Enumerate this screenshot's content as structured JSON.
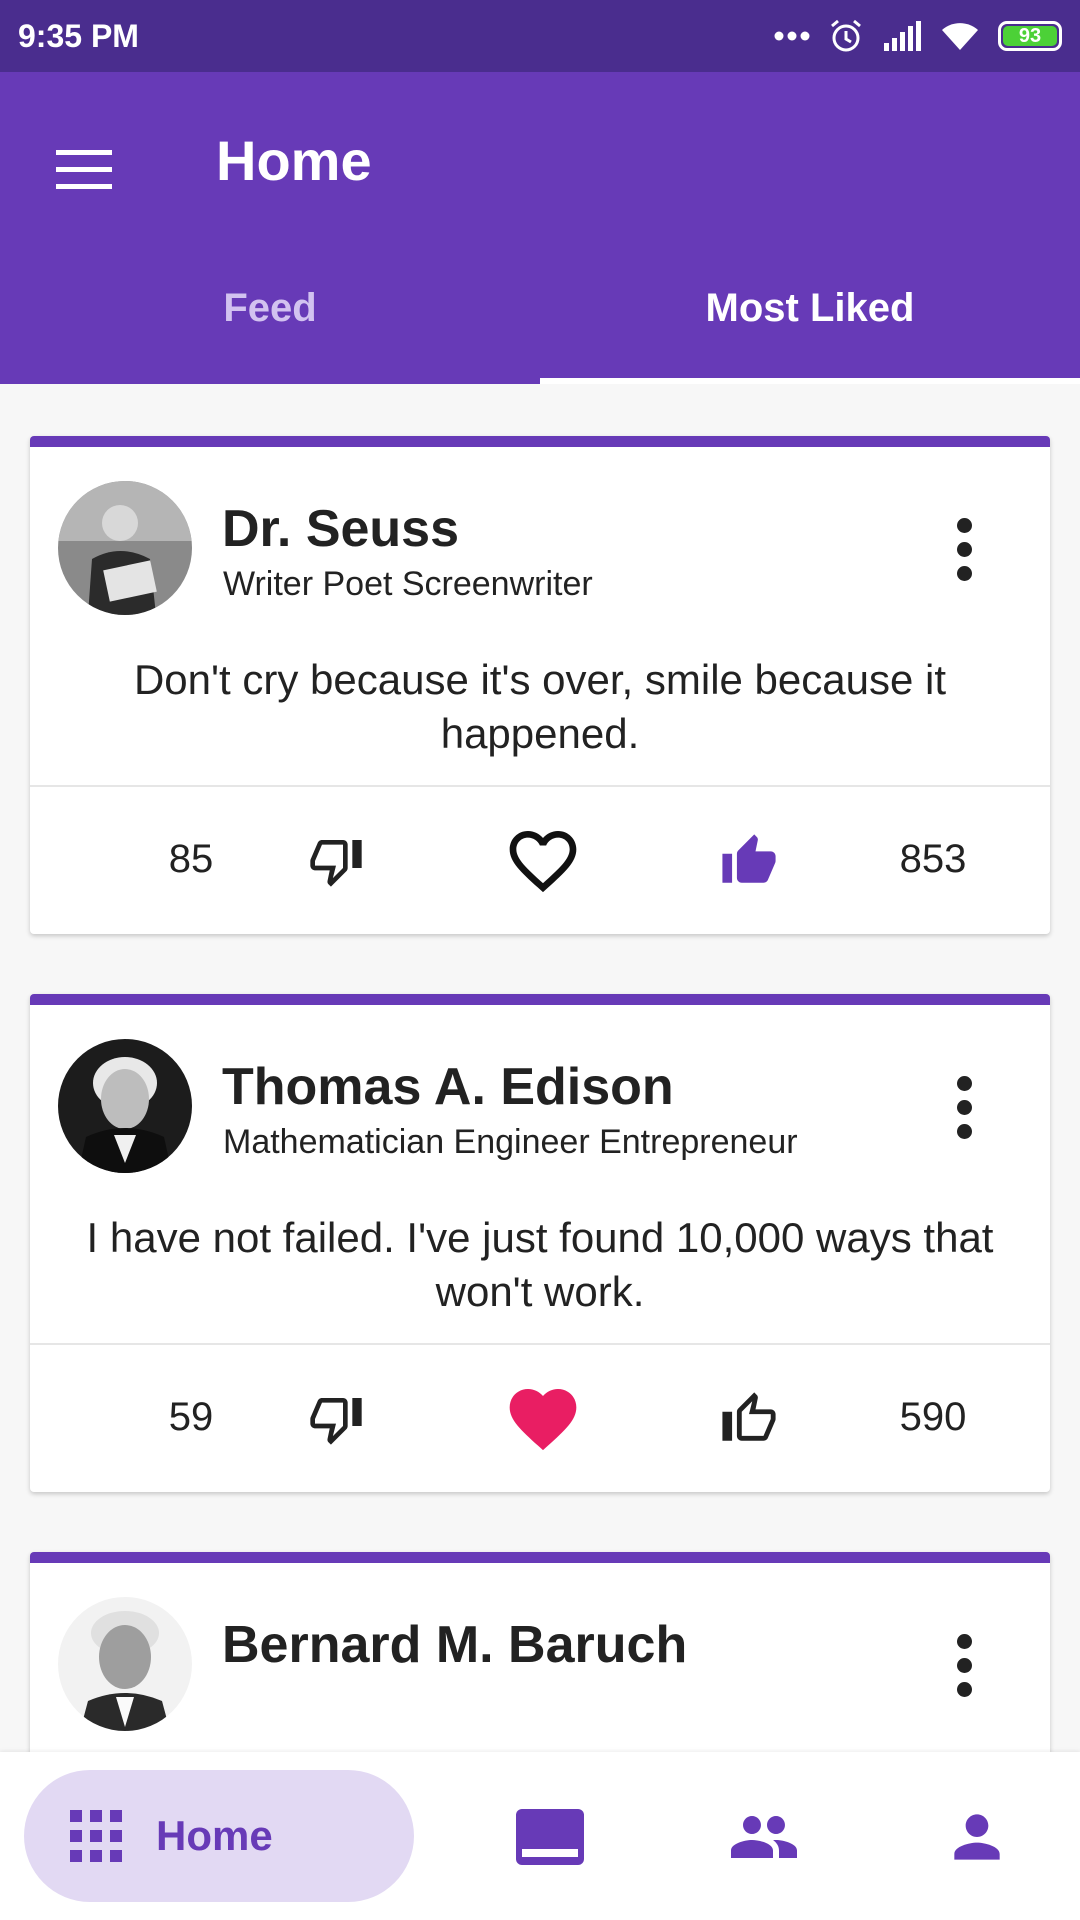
{
  "status_bar": {
    "time": "9:35 PM",
    "battery": "93"
  },
  "app_bar": {
    "title": "Home"
  },
  "tabs": [
    {
      "label": "Feed",
      "selected": false
    },
    {
      "label": "Most Liked",
      "selected": true
    }
  ],
  "colors": {
    "primary": "#673ab7",
    "status_bar": "#4a2d8e",
    "heart_active": "#e91e63",
    "nav_pill": "#e2d9f3"
  },
  "cards": [
    {
      "name": "Dr. Seuss",
      "role": "Writer Poet Screenwriter",
      "quote": "Don't cry because it's over, smile because it happened.",
      "dislikes": "85",
      "likes": "853",
      "liked": true,
      "hearted": false
    },
    {
      "name": "Thomas A. Edison",
      "role": "Mathematician Engineer Entrepreneur",
      "quote": "I have not failed. I've just found 10,000 ways that won't work.",
      "dislikes": "59",
      "likes": "590",
      "liked": false,
      "hearted": true
    },
    {
      "name": "Bernard M. Baruch",
      "role": "",
      "quote": ""
    }
  ],
  "bottom_nav": {
    "active_label": "Home",
    "items": [
      {
        "icon": "apps-grid-icon",
        "label": "Home"
      },
      {
        "icon": "feed-icon"
      },
      {
        "icon": "people-icon"
      },
      {
        "icon": "person-icon"
      }
    ]
  }
}
